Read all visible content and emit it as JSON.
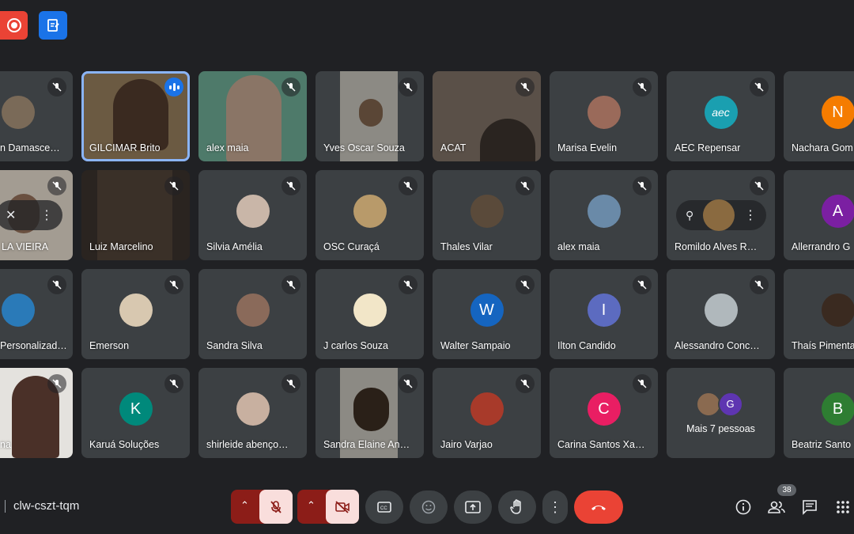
{
  "meeting": {
    "code": "clw-cszt-tqm",
    "participant_count": "38"
  },
  "colors": {
    "bg": "#202124",
    "tile": "#3c4043",
    "accent": "#8ab4f8",
    "end_call": "#ea4335",
    "muted_ctrl": "#f9dedc"
  },
  "top_buttons": [
    {
      "name": "record-indicator",
      "icon": "record-icon",
      "color": "#ea4335"
    },
    {
      "name": "activities",
      "icon": "document-icon",
      "color": "#1a73e8"
    }
  ],
  "participants": [
    [
      "n Damasce…",
      "GILCIMAR Brito",
      "alex maia",
      "Yves Oscar Souza",
      "ACAT",
      "Marisa Evelin",
      "AEC Repensar",
      "Nachara Gom"
    ],
    [
      "LA VIEIRA",
      "Luiz Marcelino",
      "Silvia Amélia",
      "OSC Curaçá",
      "Thales Vilar",
      "alex maia",
      "Romildo Alves R…",
      "Allerrandro G"
    ],
    [
      "Personalizad…",
      "Emerson",
      "Sandra Silva",
      "J carlos Souza",
      "Walter Sampaio",
      "Ilton Candido",
      "Alessandro Conc…",
      "Thaís Pimenta"
    ],
    [
      "na",
      "Karuá Soluções",
      "shirleide abenço…",
      "Sandra Elaine An…",
      "Jairo Varjao",
      "Carina Santos Xa…",
      "Mais 7 pessoas",
      "Beatriz Santo"
    ]
  ],
  "avatars": {
    "nachara": "N",
    "allerrandro": "A",
    "walter": "W",
    "ilton": "I",
    "karua": "K",
    "carina": "C",
    "beatriz": "B",
    "more_g": "G"
  },
  "controls": [
    "mic-off",
    "camera-off",
    "captions",
    "emoji",
    "present",
    "raise-hand",
    "more-options",
    "end-call"
  ],
  "right_controls": [
    "info-icon",
    "people-icon",
    "chat-icon",
    "activities-grid-icon"
  ]
}
